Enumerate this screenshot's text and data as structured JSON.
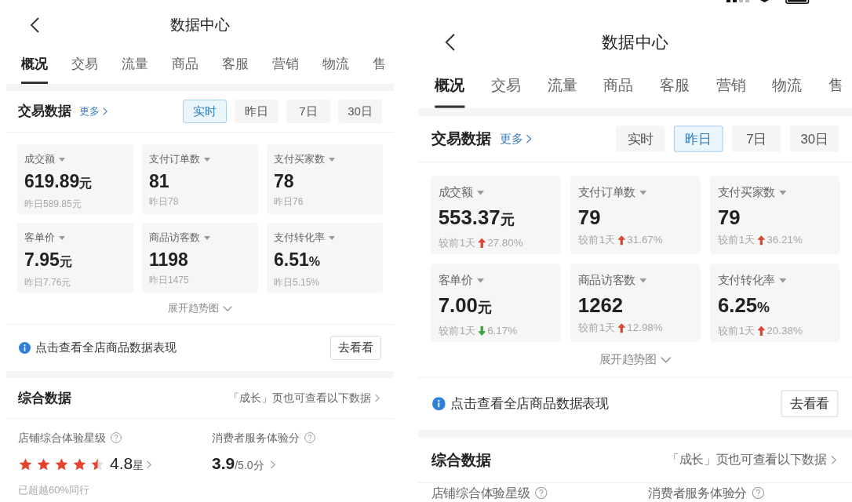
{
  "screens": [
    {
      "header": {
        "title": "数据中心"
      },
      "tabs": [
        {
          "label": "概况",
          "selected": true
        },
        {
          "label": "交易",
          "selected": false
        },
        {
          "label": "流量",
          "selected": false
        },
        {
          "label": "商品",
          "selected": false
        },
        {
          "label": "客服",
          "selected": false
        },
        {
          "label": "营销",
          "selected": false
        },
        {
          "label": "物流",
          "selected": false
        },
        {
          "label": "售",
          "selected": false
        }
      ],
      "trade_data": {
        "title": "交易数据",
        "more_link": "更多",
        "periods": [
          {
            "label": "实时",
            "selected": true
          },
          {
            "label": "昨日",
            "selected": false
          },
          {
            "label": "7日",
            "selected": false
          },
          {
            "label": "30日",
            "selected": false
          }
        ],
        "metrics": [
          {
            "label": "成交额",
            "value": "619.89",
            "unit": "元",
            "comparison": {
              "text": "昨日589.85元"
            }
          },
          {
            "label": "支付订单数",
            "value": "81",
            "comparison": {
              "text": "昨日78"
            }
          },
          {
            "label": "支付买家数",
            "value": "78",
            "comparison": {
              "text": "昨日76"
            }
          },
          {
            "label": "客单价",
            "value": "7.95",
            "unit": "元",
            "comparison": {
              "text": "昨日7.76元"
            }
          },
          {
            "label": "商品访客数",
            "value": "1198",
            "comparison": {
              "text": "昨日1475"
            }
          },
          {
            "label": "支付转化率",
            "value": "6.51",
            "unit": "%",
            "comparison": {
              "text": "昨日5.15%"
            }
          }
        ],
        "expand_link": "展开趋势图"
      },
      "notice": {
        "text": "点击查看全店商品数据表现",
        "button": "去看看"
      },
      "overall_data": {
        "title": "综合数据",
        "link": "「成长」页也可查看以下数据",
        "store_rating": {
          "label": "店铺综合体验星级",
          "stars": 4.5,
          "score": "4.8",
          "unit": "星",
          "note": "已超越60%同行"
        },
        "service_score": {
          "label": "消费者服务体验分",
          "score": "3.9",
          "total": "/5.0分"
        }
      }
    },
    {
      "status_bar_visible": true,
      "header": {
        "title": "数据中心"
      },
      "tabs": [
        {
          "label": "概况",
          "selected": true
        },
        {
          "label": "交易",
          "selected": false
        },
        {
          "label": "流量",
          "selected": false
        },
        {
          "label": "商品",
          "selected": false
        },
        {
          "label": "客服",
          "selected": false
        },
        {
          "label": "营销",
          "selected": false
        },
        {
          "label": "物流",
          "selected": false
        },
        {
          "label": "售",
          "selected": false
        }
      ],
      "trade_data": {
        "title": "交易数据",
        "more_link": "更多",
        "periods": [
          {
            "label": "实时",
            "selected": false
          },
          {
            "label": "昨日",
            "selected": true
          },
          {
            "label": "7日",
            "selected": false
          },
          {
            "label": "30日",
            "selected": false
          }
        ],
        "metrics": [
          {
            "label": "成交额",
            "value": "553.37",
            "unit": "元",
            "comparison": {
              "text": "较前1天",
              "increase": true,
              "change": "27.80%"
            }
          },
          {
            "label": "支付订单数",
            "value": "79",
            "comparison": {
              "text": "较前1天",
              "increase": true,
              "change": "31.67%"
            }
          },
          {
            "label": "支付买家数",
            "value": "79",
            "comparison": {
              "text": "较前1天",
              "increase": true,
              "change": "36.21%"
            }
          },
          {
            "label": "客单价",
            "value": "7.00",
            "unit": "元",
            "comparison": {
              "text": "较前1天",
              "increase": false,
              "change": "6.17%"
            }
          },
          {
            "label": "商品访客数",
            "value": "1262",
            "comparison": {
              "text": "较前1天",
              "increase": true,
              "change": "12.98%"
            }
          },
          {
            "label": "支付转化率",
            "value": "6.25",
            "unit": "%",
            "comparison": {
              "text": "较前1天",
              "increase": true,
              "change": "20.38%"
            }
          }
        ],
        "expand_link": "展开趋势图"
      },
      "notice": {
        "text": "点击查看全店商品数据表现",
        "button": "去看看"
      },
      "overall_data": {
        "title": "综合数据",
        "link": "「成长」页也可查看以下数据",
        "store_rating": {
          "label": "店铺综合体验星级"
        },
        "service_score": {
          "label": "消费者服务体验分"
        }
      }
    }
  ]
}
